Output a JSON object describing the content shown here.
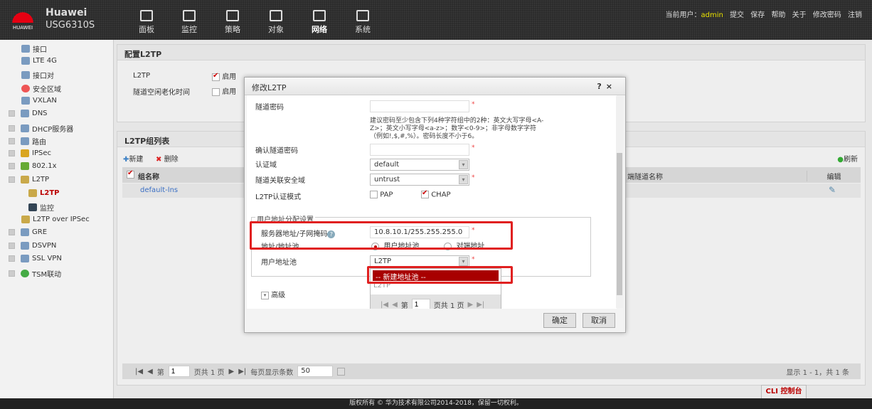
{
  "header": {
    "logo_text": "HUAWEI",
    "brand": "Huawei",
    "model": "USG6310S",
    "nav": [
      {
        "label": "面板",
        "icon": "dashboard-icon"
      },
      {
        "label": "监控",
        "icon": "monitor-icon"
      },
      {
        "label": "策略",
        "icon": "policy-icon"
      },
      {
        "label": "对象",
        "icon": "object-icon"
      },
      {
        "label": "网络",
        "icon": "network-icon",
        "active": true
      },
      {
        "label": "系统",
        "icon": "system-icon"
      }
    ],
    "user_label": "当前用户：",
    "user": "admin",
    "links": [
      "提交",
      "保存",
      "帮助",
      "关于",
      "修改密码",
      "注销"
    ]
  },
  "sidebar": {
    "items": [
      {
        "label": "接口"
      },
      {
        "label": "LTE 4G"
      },
      {
        "label": "接口对"
      },
      {
        "label": "安全区域"
      },
      {
        "label": "VXLAN"
      },
      {
        "label": "DNS"
      },
      {
        "label": "DHCP服务器"
      },
      {
        "label": "路由"
      },
      {
        "label": "IPSec"
      },
      {
        "label": "802.1x"
      },
      {
        "label": "L2TP"
      },
      {
        "label": "L2TP",
        "selected": true
      },
      {
        "label": "监控"
      },
      {
        "label": "L2TP over IPSec"
      },
      {
        "label": "GRE"
      },
      {
        "label": "DSVPN"
      },
      {
        "label": "SSL VPN"
      },
      {
        "label": "TSM联动"
      }
    ]
  },
  "config": {
    "title": "配置L2TP",
    "rows": [
      {
        "label": "L2TP",
        "check": "启用",
        "checked": true
      },
      {
        "label": "隧道空闲老化时间",
        "check": "启用",
        "checked": false
      }
    ]
  },
  "list": {
    "title": "L2TP组列表",
    "new": "新建",
    "delete": "删除",
    "refresh": "刷新",
    "columns": [
      "组名称",
      "端隧道名称",
      "编辑"
    ],
    "rows": [
      {
        "name": "default-lns"
      }
    ],
    "pager": {
      "page_prefix": "第",
      "page": "1",
      "page_suffix": "页共 1 页",
      "per_page_label": "每页显示条数",
      "per_page": "50",
      "summary": "显示 1 - 1，共 1 条"
    }
  },
  "dialog": {
    "title": "修改L2TP",
    "help": "?",
    "close": "×",
    "tunnel_password_label": "隧道密码",
    "tunnel_password": "",
    "hint": "建议密码至少包含下列4种字符组中的2种：英文大写字母<A-Z>；英文小写字母<a-z>；数字<0-9>；非字母数字字符（例如!,$,#,%）。密码长度不小于6。",
    "confirm_password_label": "确认隧道密码",
    "confirm_password": "",
    "auth_domain_label": "认证域",
    "auth_domain": "default",
    "zone_label": "隧道关联安全域",
    "zone": "untrust",
    "auth_mode_label": "L2TP认证模式",
    "pap": "PAP",
    "pap_checked": false,
    "chap": "CHAP",
    "chap_checked": true,
    "fieldset": "用户地址分配设置",
    "server_addr_label": "服务器地址/子网掩码",
    "server_addr": "10.8.10.1/255.255.255.0",
    "addr_mode_label": "地址/地址池",
    "addr_opt1": "用户地址池",
    "addr_opt2": "对端地址",
    "addr_selected": "用户地址池",
    "pool_label": "用户地址池",
    "pool": "L2TP",
    "pool_options": [
      "-- 新建地址池 --",
      "L2TP"
    ],
    "pool_highlighted": "-- 新建地址池 --",
    "pool_pager": {
      "prefix": "第",
      "page": "1",
      "suffix": "页共 1 页"
    },
    "advanced": "高级",
    "ok": "确定",
    "cancel": "取消"
  },
  "footer": {
    "copyright": "版权所有 © 华为技术有限公司2014-2018，保留一切权利。",
    "cli": "CLI 控制台"
  },
  "colors": {
    "accent": "#a80000",
    "highlight_box": "#e02020",
    "topbar": "#2b2b2b",
    "user": "#e8e000"
  }
}
